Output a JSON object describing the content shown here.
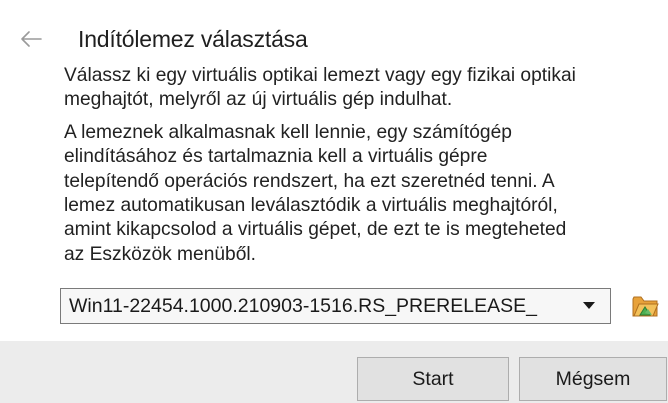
{
  "header": {
    "back_icon": "arrow-left-icon",
    "title": "Indítólemez választása"
  },
  "content": {
    "paragraph1_lines": [
      "Válassz ki egy virtuális optikai lemezt vagy egy fizikai optikai",
      "meghajtót, melyről az új virtuális gép indulhat."
    ],
    "paragraph2_lines": [
      "A lemeznek alkalmasnak kell lennie, egy számítógép",
      "elindításához és tartalmaznia kell a virtuális gépre",
      "telepítendő operációs rendszert, ha ezt szeretnéd tenni. A",
      "lemez automatikusan leválasztódik a virtuális meghajtóról,",
      "amint kikapcsolod a virtuális gépet, de ezt te is megteheted",
      "az Eszközök menüből."
    ]
  },
  "disk_picker": {
    "selected_value": "Win11-22454.1000.210903-1516.RS_PRERELEASE_",
    "dropdown_icon": "chevron-down-icon",
    "browse_icon": "folder-icon"
  },
  "buttons": {
    "start_label": "Start",
    "cancel_label": "Mégsem"
  },
  "colors": {
    "footer_bg": "#ececec",
    "folder_orange": "#e8a23a",
    "folder_green": "#4caf50"
  }
}
